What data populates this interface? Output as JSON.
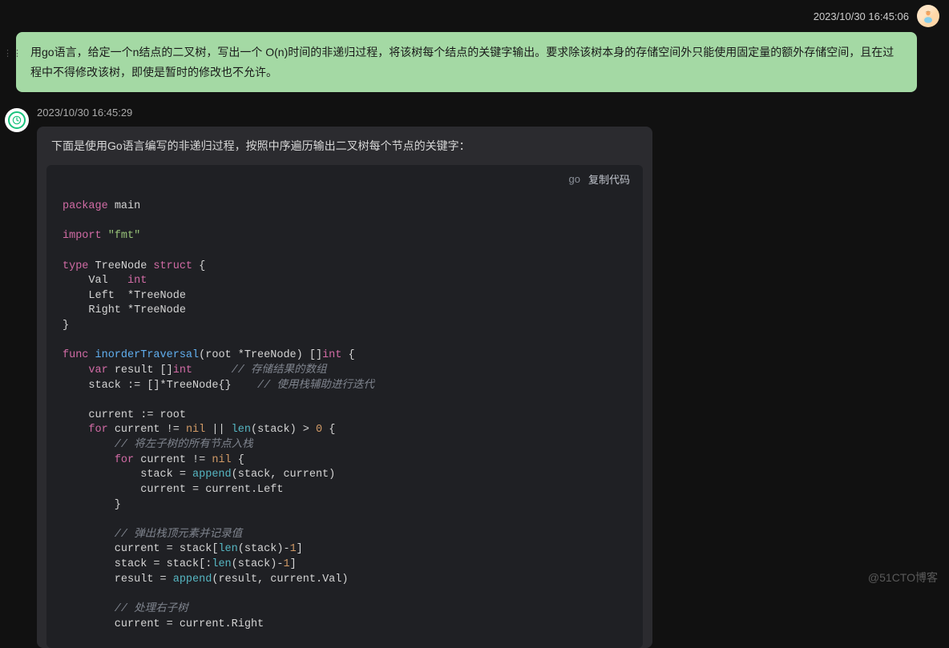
{
  "user": {
    "timestamp": "2023/10/30 16:45:06",
    "message": "用go语言，给定一个n结点的二叉树，写出一个 O(n)时间的非递归过程，将该树每个结点的关键字输出。要求除该树本身的存储空间外只能使用固定量的额外存储空间，且在过程中不得修改该树，即使是暂时的修改也不允许。"
  },
  "ai": {
    "timestamp": "2023/10/30 16:45:29",
    "intro": "下面是使用Go语言编写的非递归过程，按照中序遍历输出二叉树每个节点的关键字：",
    "code_lang": "go",
    "copy_label": "复制代码",
    "code": {
      "kw_package": "package",
      "pkg_name": " main",
      "kw_import": "import",
      "import_val": " \"fmt\"",
      "kw_type": "type",
      "type_name": " TreeNode ",
      "kw_struct": "struct",
      "brace_open": " {",
      "field_val": "    Val   ",
      "t_int": "int",
      "field_left": "    Left  *TreeNode",
      "field_right": "    Right *TreeNode",
      "brace_close": "}",
      "kw_func": "func",
      "fn_name": " inorderTraversal",
      "fn_sig_open": "(root *TreeNode) []",
      "fn_sig_int": "int",
      "fn_sig_close": " {",
      "kw_var": "var",
      "var_result": " result []",
      "var_int": "int",
      "comment1": "      // 存储结果的数组",
      "stack_line": "    stack := []*TreeNode{}   ",
      "comment2": " // 使用栈辅助进行迭代",
      "current_line": "    current := root",
      "kw_for1": "for",
      "for1_rest": " current != ",
      "nil1": "nil",
      "for1_mid": " || ",
      "len1": "len",
      "for1_end": "(stack) > ",
      "zero": "0",
      "for1_brace": " {",
      "comment3": "        // 将左子树的所有节点入栈",
      "kw_for2": "for",
      "for2_rest": " current != ",
      "nil2": "nil",
      "for2_brace": " {",
      "append_line_pre": "            stack = ",
      "append_fn": "append",
      "append_args": "(stack, current)",
      "cur_left": "            current = current.Left",
      "close1": "        }",
      "comment4": "        // 弹出栈顶元素并记录值",
      "pop1_pre": "        current = stack[",
      "len2": "len",
      "pop1_mid": "(stack)-",
      "one1": "1",
      "pop1_end": "]",
      "pop2_pre": "        stack = stack[:",
      "len3": "len",
      "pop2_mid": "(stack)-",
      "one2": "1",
      "pop2_end": "]",
      "res_pre": "        result = ",
      "append_fn2": "append",
      "res_args": "(result, current.Val)",
      "comment5": "        // 处理右子树",
      "cur_right": "        current = current.Right"
    }
  },
  "watermark": "@51CTO博客"
}
